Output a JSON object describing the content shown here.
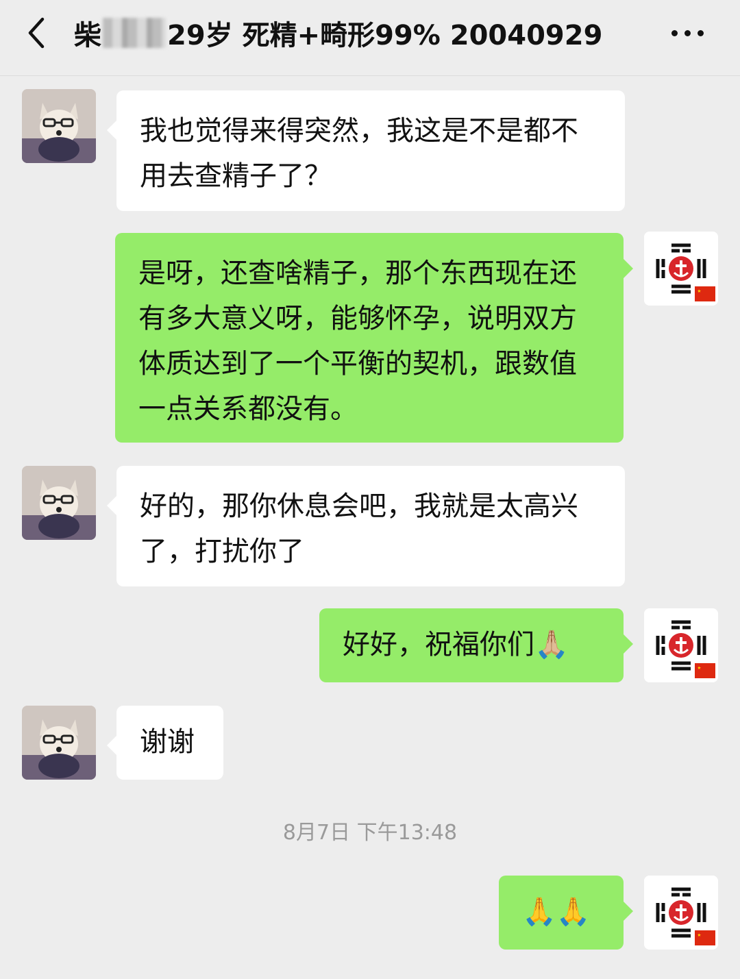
{
  "header": {
    "title_prefix": "柴",
    "title_suffix": "29岁 死精+畸形99% 20040929",
    "back_icon": "chevron-left-icon",
    "more_icon": "ellipsis-icon"
  },
  "messages": [
    {
      "side": "left",
      "text": "我也觉得来得突然，我这是不是都不用去查精子了？"
    },
    {
      "side": "right",
      "text": "是呀，还查啥精子，那个东西现在还有多大意义呀，能够怀孕，说明双方体质达到了一个平衡的契机，跟数值一点关系都没有。"
    },
    {
      "side": "left",
      "text": "好的，那你休息会吧，我就是太高兴了，打扰你了"
    },
    {
      "side": "right",
      "text": "好好，祝福你们🙏🏼"
    },
    {
      "side": "left",
      "text": "谢谢"
    },
    {
      "side": "right",
      "text": "🙏🙏"
    }
  ],
  "timestamp": "8月7日 下午13:48",
  "colors": {
    "background": "#ededed",
    "sent_bubble": "#95ec69",
    "received_bubble": "#ffffff",
    "timestamp_text": "#9a9a9a"
  }
}
